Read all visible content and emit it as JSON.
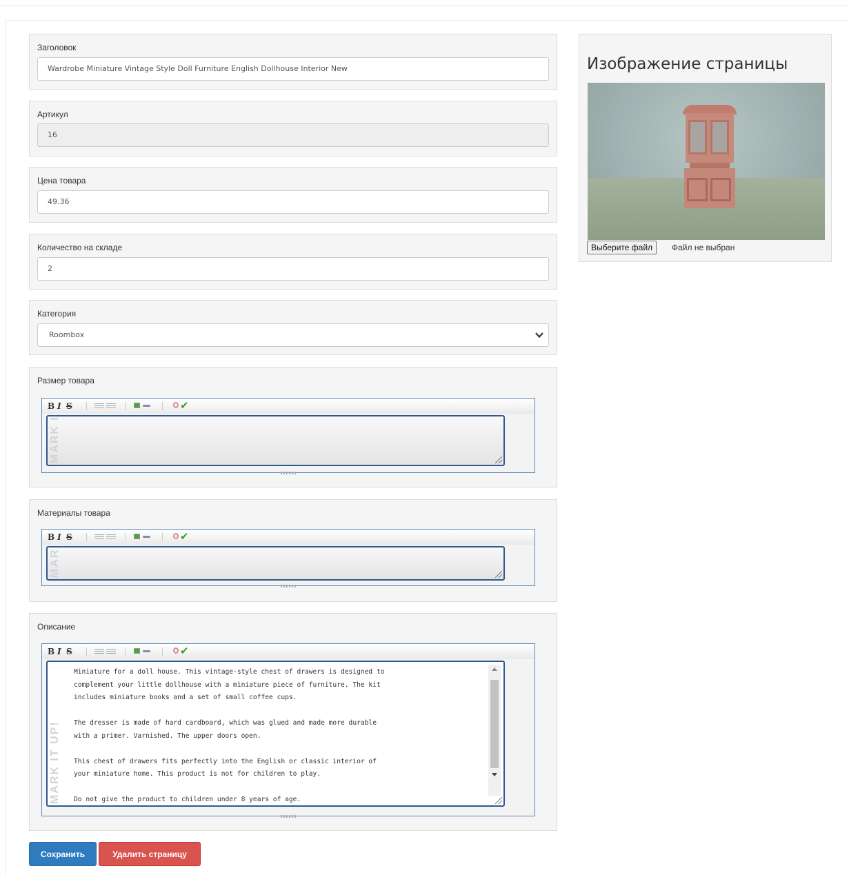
{
  "form": {
    "title": {
      "label": "Заголовок",
      "value": "Wardrobe Miniature Vintage Style Doll Furniture English Dollhouse Interior New"
    },
    "sku": {
      "label": "Артикул",
      "value": "16"
    },
    "price": {
      "label": "Цена товара",
      "value": "49.36"
    },
    "stock": {
      "label": "Количество на складе",
      "value": "2"
    },
    "category": {
      "label": "Категория",
      "value": "Roombox"
    },
    "size": {
      "label": "Размер товара",
      "value": ""
    },
    "materials": {
      "label": "Материалы товара",
      "value": ""
    },
    "description": {
      "label": "Описание",
      "value": "Miniature for a doll house. This vintage-style chest of drawers is designed to\ncomplement your little dollhouse with a miniature piece of furniture. The kit\nincludes miniature books and a set of small coffee cups.\n\nThe dresser is made of hard cardboard, which was glued and made more durable\nwith a primer. Varnished. The upper doors open.\n\nThis chest of drawers fits perfectly into the English or classic interior of\nyour miniature home. This product is not for children to play.\n\nDo not give the product to children under 8 years of age."
    }
  },
  "editor": {
    "toolbar": {
      "bold": "B",
      "italic": "I",
      "strike": "S"
    },
    "watermark": "MARK IT UP!"
  },
  "image_panel": {
    "title": "Изображение страницы",
    "file_button": "Выберите файл",
    "file_status": "Файл не выбран"
  },
  "actions": {
    "save": "Сохранить",
    "delete": "Удалить страницу"
  }
}
